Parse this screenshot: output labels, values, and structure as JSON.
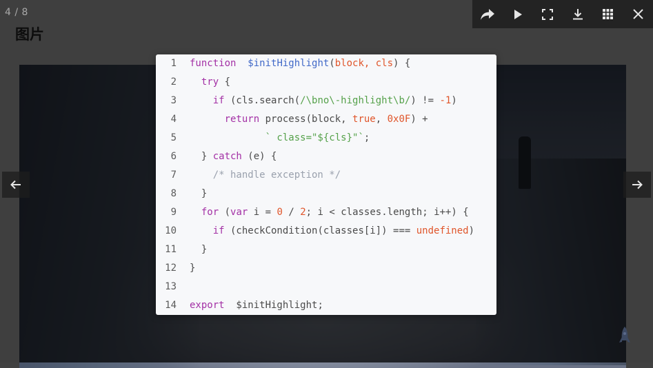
{
  "counter": "4 / 8",
  "page": {
    "title": "图片"
  },
  "toolbar": {
    "buttons": [
      "share-icon",
      "play-icon",
      "fullscreen-icon",
      "download-icon",
      "grid-icon",
      "close-icon"
    ]
  },
  "code": {
    "lines": [
      {
        "n": "1",
        "tokens": [
          [
            "kw",
            "function"
          ],
          [
            "",
            "  "
          ],
          [
            "fn",
            "$initHighlight"
          ],
          [
            "",
            "("
          ],
          [
            "par",
            "block, cls"
          ],
          [
            "",
            ") {"
          ]
        ]
      },
      {
        "n": "2",
        "tokens": [
          [
            "",
            "  "
          ],
          [
            "kw",
            "try"
          ],
          [
            "",
            " {"
          ]
        ]
      },
      {
        "n": "3",
        "tokens": [
          [
            "",
            "    "
          ],
          [
            "kw",
            "if"
          ],
          [
            "",
            " (cls.search("
          ],
          [
            "str",
            "/\\bno\\-highlight\\b/"
          ],
          [
            "",
            ") != "
          ],
          [
            "num",
            "-1"
          ],
          [
            "",
            ")"
          ]
        ]
      },
      {
        "n": "4",
        "tokens": [
          [
            "",
            "      "
          ],
          [
            "kw",
            "return"
          ],
          [
            "",
            " process(block, "
          ],
          [
            "lit",
            "true"
          ],
          [
            "",
            ", "
          ],
          [
            "num",
            "0x0F"
          ],
          [
            "",
            ") +"
          ]
        ]
      },
      {
        "n": "5",
        "tokens": [
          [
            "",
            "             "
          ],
          [
            "str",
            "` class=\"${cls}\"`"
          ],
          [
            "",
            ";"
          ]
        ]
      },
      {
        "n": "6",
        "tokens": [
          [
            "",
            "  } "
          ],
          [
            "kw",
            "catch"
          ],
          [
            "",
            " (e) {"
          ]
        ]
      },
      {
        "n": "7",
        "tokens": [
          [
            "",
            "    "
          ],
          [
            "cmt",
            "/* handle exception */"
          ]
        ]
      },
      {
        "n": "8",
        "tokens": [
          [
            "",
            "  }"
          ]
        ]
      },
      {
        "n": "9",
        "tokens": [
          [
            "",
            "  "
          ],
          [
            "kw",
            "for"
          ],
          [
            "",
            " ("
          ],
          [
            "kw",
            "var"
          ],
          [
            "",
            " i = "
          ],
          [
            "num",
            "0"
          ],
          [
            "",
            " / "
          ],
          [
            "num",
            "2"
          ],
          [
            "",
            "; i < classes.length; i++) {"
          ]
        ]
      },
      {
        "n": "10",
        "tokens": [
          [
            "",
            "    "
          ],
          [
            "kw",
            "if"
          ],
          [
            "",
            " (checkCondition(classes[i]) === "
          ],
          [
            "lit",
            "undefined"
          ],
          [
            "",
            ")"
          ]
        ]
      },
      {
        "n": "11",
        "tokens": [
          [
            "",
            "  }"
          ]
        ]
      },
      {
        "n": "12",
        "tokens": [
          [
            "",
            "}"
          ]
        ]
      },
      {
        "n": "13",
        "tokens": []
      },
      {
        "n": "14",
        "tokens": [
          [
            "kw",
            "export"
          ],
          [
            "",
            "  $initHighlight;"
          ]
        ]
      }
    ]
  }
}
